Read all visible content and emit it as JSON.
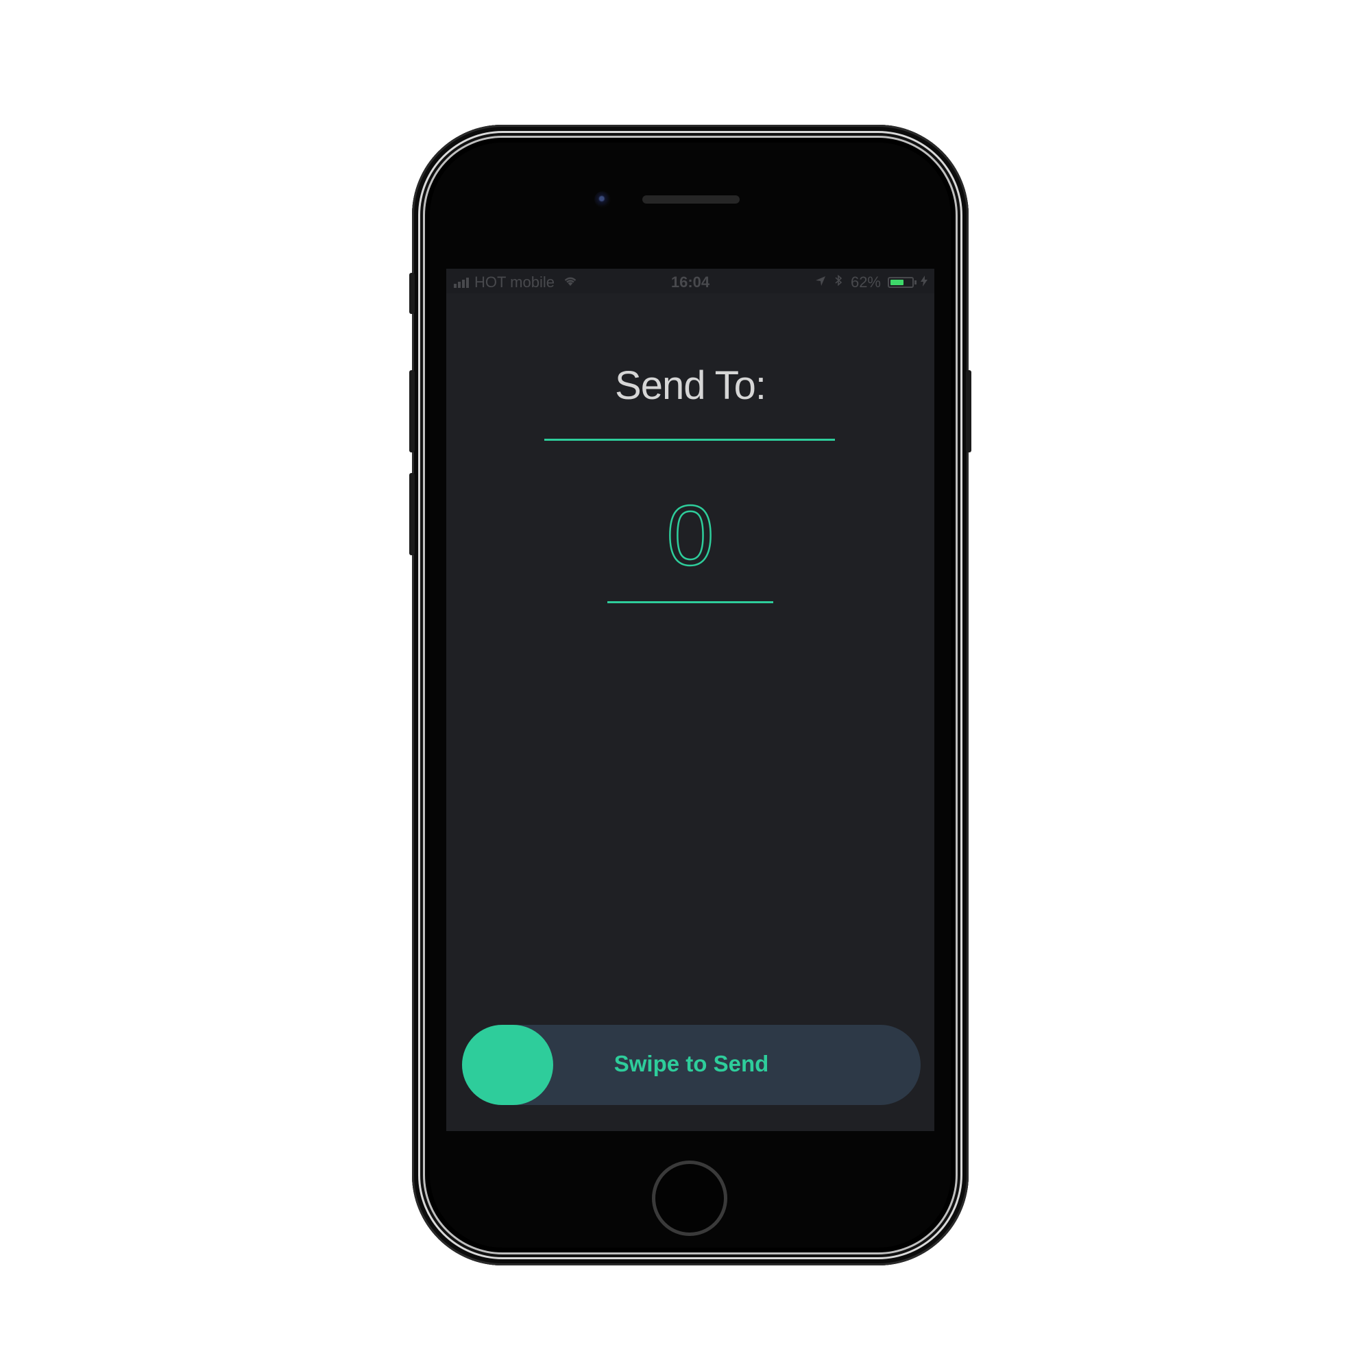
{
  "status_bar": {
    "carrier": "HOT mobile",
    "time": "16:04",
    "battery_percent_label": "62%",
    "battery_level": 0.62,
    "icons": [
      "signal-icon",
      "wifi-icon",
      "location-icon",
      "bluetooth-icon",
      "battery-icon",
      "charging-bolt-icon"
    ]
  },
  "form": {
    "send_to_label": "Send To:",
    "recipient_value": "",
    "amount_value": "0"
  },
  "swipe": {
    "label": "Swipe to Send"
  },
  "colors": {
    "accent": "#2ecd9b",
    "screen_background": "#1f2024",
    "swipe_track": "#2d3947",
    "battery_fill": "#3ed96a"
  }
}
